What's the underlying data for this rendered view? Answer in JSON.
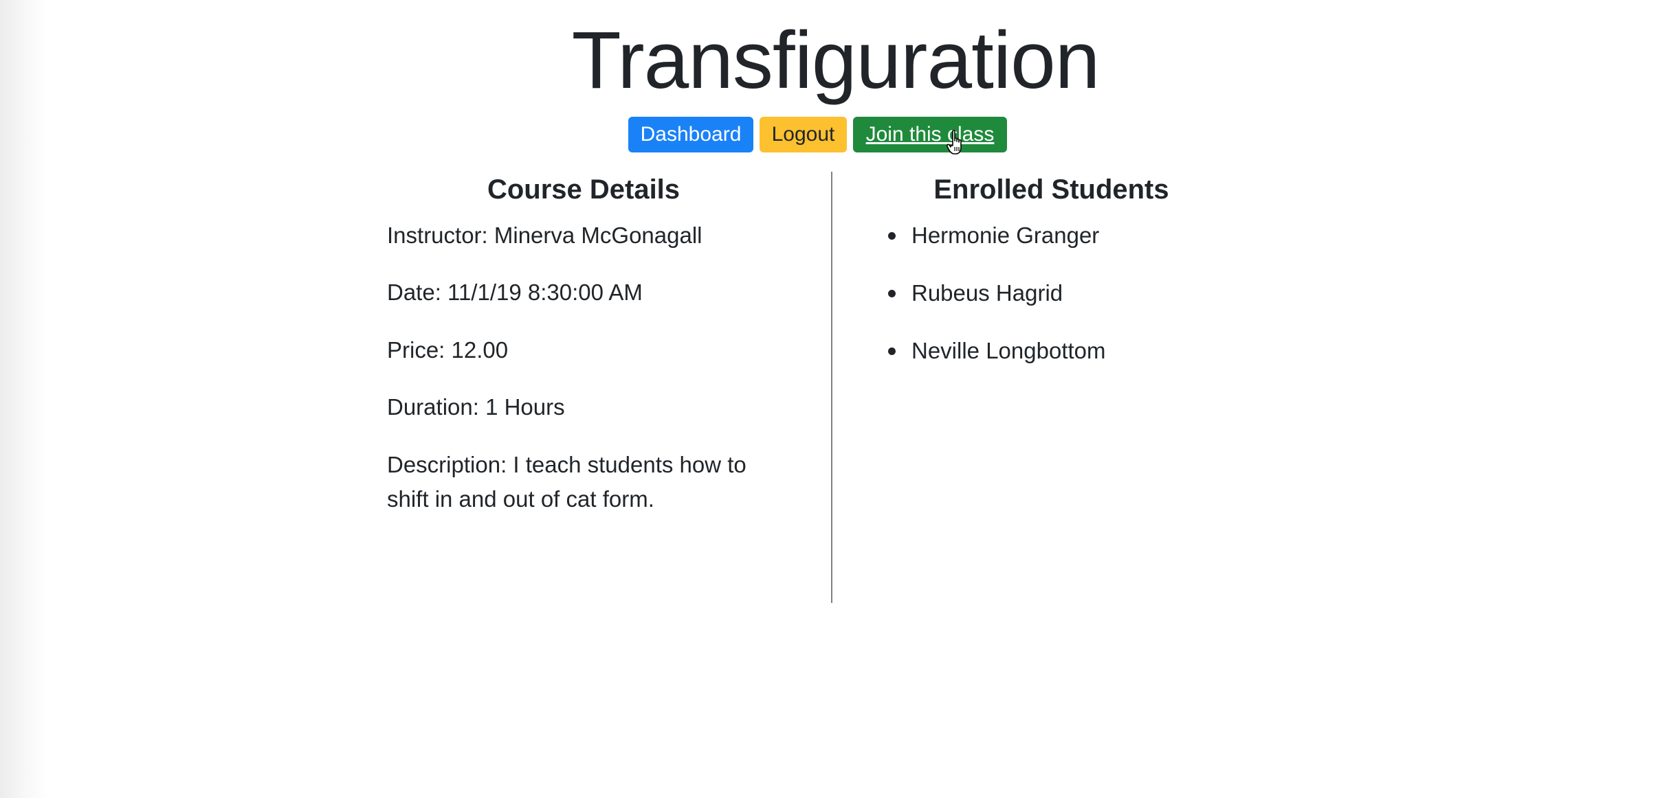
{
  "page": {
    "title": "Transfiguration"
  },
  "nav": {
    "dashboard_label": "Dashboard",
    "logout_label": "Logout",
    "join_label": "Join this class"
  },
  "course_details": {
    "heading": "Course Details",
    "instructor": "Instructor: Minerva McGonagall",
    "date": "Date: 11/1/19 8:30:00 AM",
    "price": "Price: 12.00",
    "duration": "Duration: 1 Hours",
    "description": "Description: I teach students how to shift in and out of cat form."
  },
  "enrolled_students": {
    "heading": "Enrolled Students",
    "students": [
      "Hermonie Granger",
      "Rubeus Hagrid",
      "Neville Longbottom"
    ]
  },
  "colors": {
    "primary": "#1a82f7",
    "warning": "#fdc02f",
    "success": "#1f8a3c",
    "text": "#212529"
  },
  "icons": {
    "cursor": "hand-pointer-icon"
  }
}
